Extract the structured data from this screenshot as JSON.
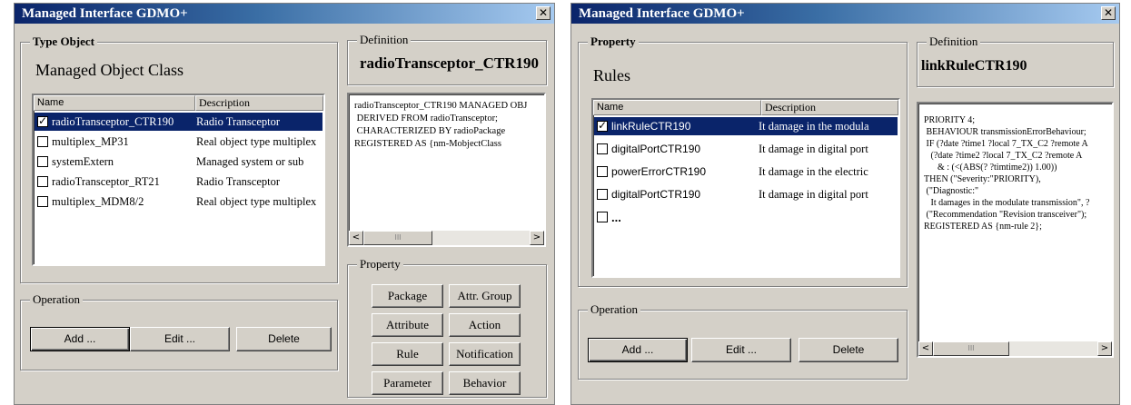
{
  "left": {
    "title": "Managed Interface GDMO+",
    "close": "✕",
    "type_object": {
      "label": "Type Object",
      "heading": "Managed Object Class",
      "columns": [
        "Name",
        "Description"
      ],
      "rows": [
        {
          "name": "radioTransceptor_CTR190",
          "desc": "Radio Transceptor",
          "checked": true,
          "selected": true
        },
        {
          "name": "multiplex_MP31",
          "desc": "Real object type multiplex",
          "checked": false,
          "selected": false
        },
        {
          "name": "systemExtern",
          "desc": "Managed system or sub",
          "checked": false,
          "selected": false
        },
        {
          "name": "radioTransceptor_RT21",
          "desc": "Radio Transceptor",
          "checked": false,
          "selected": false
        },
        {
          "name": "multiplex_MDM8/2",
          "desc": "Real object type multiplex",
          "checked": false,
          "selected": false
        }
      ]
    },
    "definition": {
      "label": "Definition",
      "name": "radioTransceptor_CTR190",
      "text": "radioTransceptor_CTR190 MANAGED OBJ\n DERIVED FROM radioTransceptor;\n CHARACTERIZED BY radioPackage\nREGISTERED AS {nm-MobjectClass"
    },
    "operation": {
      "label": "Operation",
      "add": "Add ...",
      "edit": "Edit ...",
      "delete": "Delete"
    },
    "property": {
      "label": "Property",
      "buttons": {
        "package": "Package",
        "attr_group": "Attr. Group",
        "attribute": "Attribute",
        "action": "Action",
        "rule": "Rule",
        "notification": "Notification",
        "parameter": "Parameter",
        "behavior": "Behavior"
      }
    }
  },
  "right": {
    "title": "Managed Interface GDMO+",
    "close": "✕",
    "property": {
      "label": "Property",
      "heading": "Rules",
      "columns": [
        "Name",
        "Description"
      ],
      "rows": [
        {
          "name": "linkRuleCTR190",
          "desc": "It damage in the modula",
          "checked": true,
          "selected": true
        },
        {
          "name": "digitalPortCTR190",
          "desc": "It damage in digital port",
          "checked": false,
          "selected": false
        },
        {
          "name": "powerErrorCTR190",
          "desc": "It damage in the electric",
          "checked": false,
          "selected": false
        },
        {
          "name": "digitalPortCTR190",
          "desc": "It damage in digital port",
          "checked": false,
          "selected": false
        },
        {
          "name": "...",
          "desc": "",
          "checked": false,
          "selected": false
        }
      ]
    },
    "definition": {
      "label": "Definition",
      "name": "linkRuleCTR190",
      "text": "PRIORITY 4;\n BEHAVIOUR transmissionErrorBehaviour;\n IF (?date ?time1 ?local 7_TX_C2 ?remote A\n   (?date ?time2 ?local 7_TX_C2 ?remote A\n      & : (<(ABS(? ?timtime2)) 1.00))\nTHEN (\"Severity:\"PRIORITY),\n (\"Diagnostic:\"\n   It damages in the modulate transmission\", ?\n (\"Recommendation \"Revision transceiver\");\nREGISTERED AS {nm-rule 2};"
    },
    "operation": {
      "label": "Operation",
      "add": "Add ...",
      "edit": "Edit ...",
      "delete": "Delete"
    }
  },
  "scroll": {
    "left_arrow": "<",
    "right_arrow": ">",
    "thumb_grip": "III"
  }
}
